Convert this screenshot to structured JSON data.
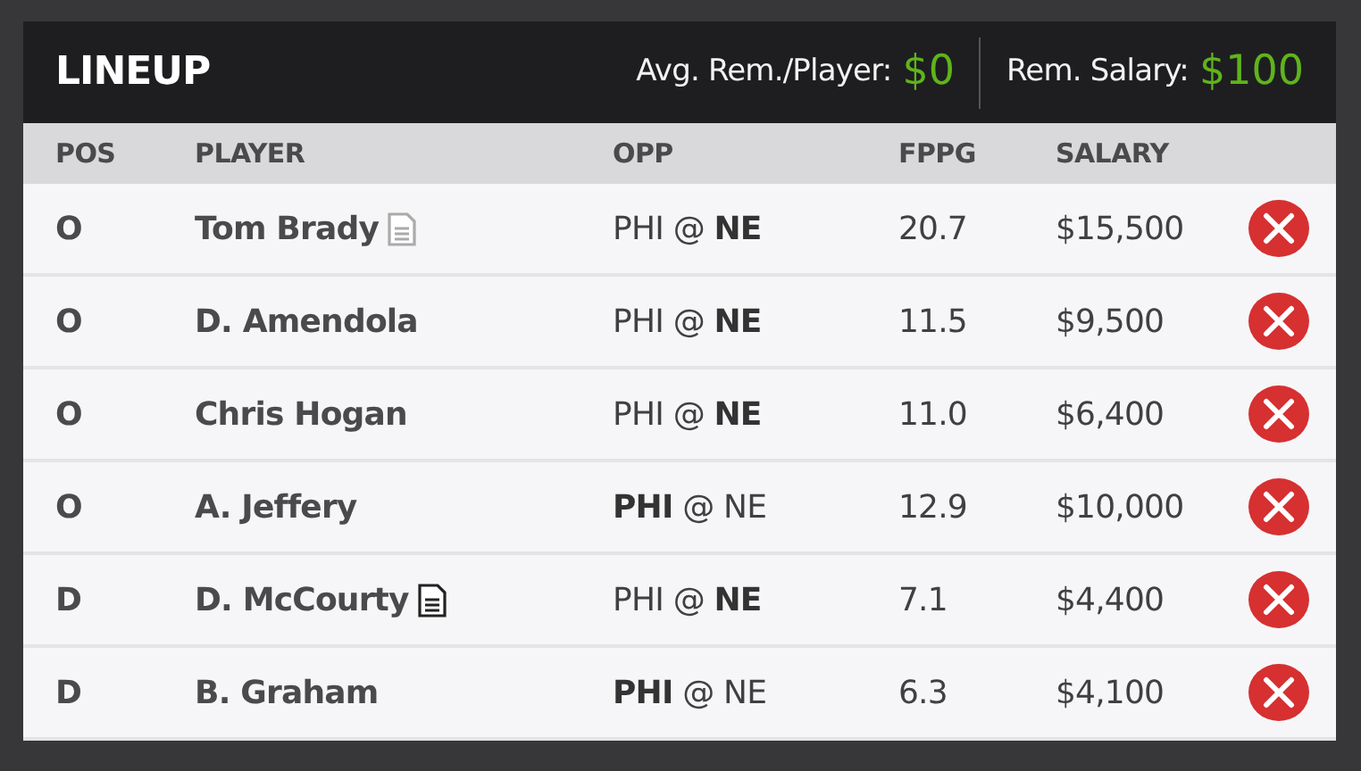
{
  "header": {
    "title": "LINEUP",
    "stats": [
      {
        "label": "Avg. Rem./Player:",
        "value": "$0"
      },
      {
        "label": "Rem. Salary:",
        "value": "$100"
      }
    ]
  },
  "table": {
    "columns": [
      "POS",
      "PLAYER",
      "OPP",
      "FPPG",
      "SALARY"
    ],
    "rows": [
      {
        "pos": "O",
        "player": "Tom Brady",
        "note": {
          "unread": false
        },
        "opp": "PHI @ **NE**",
        "fppg": "20.7",
        "salary": "$15,500"
      },
      {
        "pos": "O",
        "player": "D. Amendola",
        "opp": "PHI @ **NE**",
        "fppg": "11.5",
        "salary": "$9,500"
      },
      {
        "pos": "O",
        "player": "Chris Hogan",
        "opp": "PHI @ **NE**",
        "fppg": "11.0",
        "salary": "$6,400"
      },
      {
        "pos": "O",
        "player": "A. Jeffery",
        "opp": "**PHI** @ NE",
        "fppg": "12.9",
        "salary": "$10,000"
      },
      {
        "pos": "D",
        "player": "D. McCourty",
        "note": {
          "unread": true
        },
        "opp": "PHI @ **NE**",
        "fppg": "7.1",
        "salary": "$4,400"
      },
      {
        "pos": "D",
        "player": "B. Graham",
        "opp": "**PHI** @ NE",
        "fppg": "6.3",
        "salary": "$4,100"
      }
    ]
  }
}
